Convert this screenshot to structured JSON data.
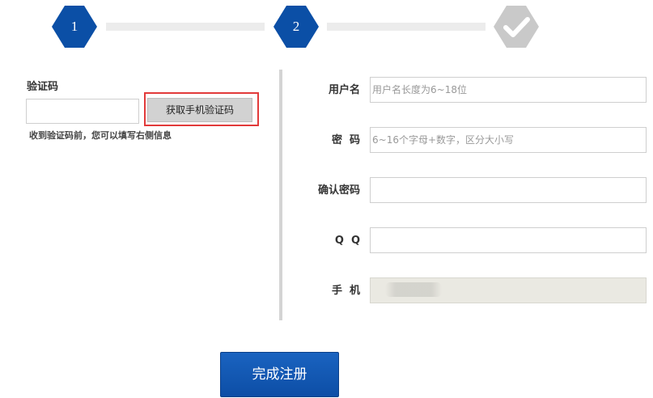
{
  "steps": [
    {
      "label": "1",
      "status": "active",
      "color": "#0b4fa6"
    },
    {
      "label": "2",
      "status": "active",
      "color": "#0b4fa6"
    },
    {
      "label": "",
      "status": "pending",
      "color": "#c9c9c9",
      "icon": "check-icon"
    }
  ],
  "verification": {
    "title": "验证码",
    "input_value": "",
    "button_label": "获取手机验证码",
    "hint": "收到验证码前，您可以填写右侧信息"
  },
  "form": {
    "username": {
      "label": "用户名",
      "placeholder": "用户名长度为6~18位",
      "value": ""
    },
    "password": {
      "label": "密  码",
      "placeholder": "6~16个字母+数字，区分大小写",
      "value": ""
    },
    "confirm_password": {
      "label": "确认密码",
      "placeholder": "",
      "value": ""
    },
    "qq": {
      "label": "Q  Q",
      "placeholder": "",
      "value": ""
    },
    "phone": {
      "label": "手  机",
      "value": "",
      "disabled": true
    }
  },
  "submit": {
    "label": "完成注册"
  },
  "colors": {
    "brand": "#0b4fa6",
    "highlight": "#e23a3a",
    "pending": "#c9c9c9"
  }
}
